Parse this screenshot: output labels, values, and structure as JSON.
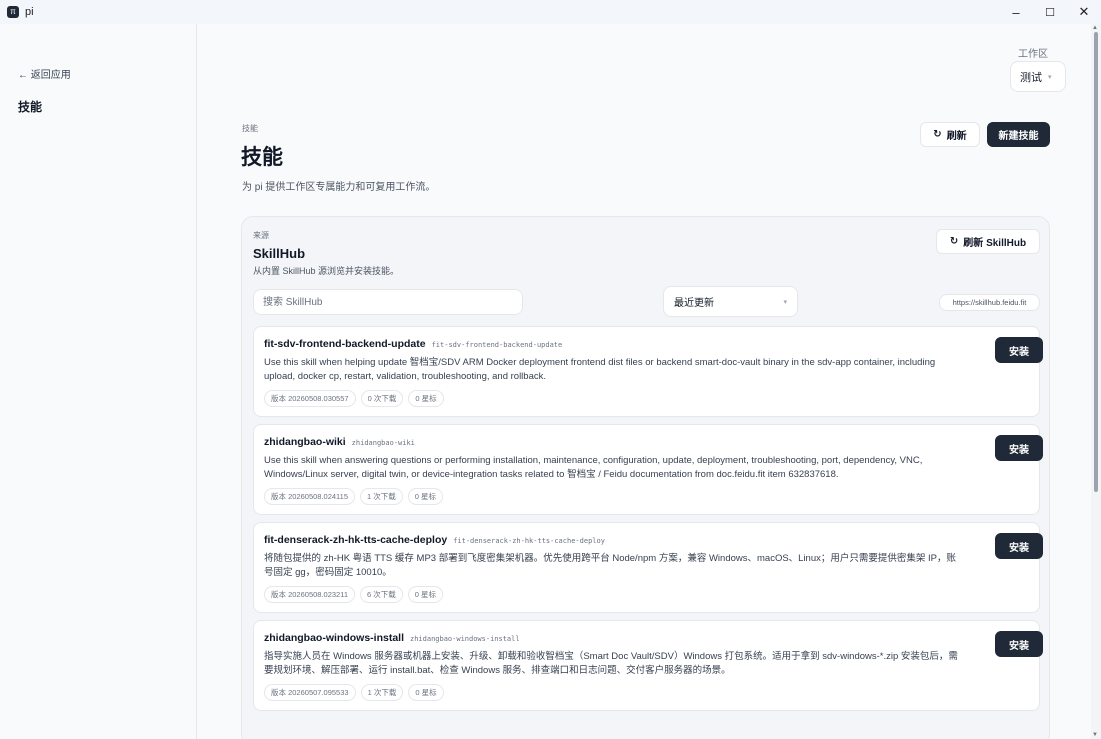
{
  "window": {
    "app_icon": "π",
    "title": "pi",
    "minimize": "–",
    "maximize": "☐",
    "close": "✕"
  },
  "sidebar": {
    "back_label": "← 返回应用",
    "heading": "技能"
  },
  "workspace": {
    "label": "工作区",
    "value": "测试",
    "caret": "▾"
  },
  "header": {
    "breadcrumb": "技能",
    "title": "技能",
    "description": "为 pi 提供工作区专属能力和可复用工作流。",
    "refresh_label": "刷新",
    "refresh_icon": "↻",
    "new_label": "新建技能"
  },
  "source": {
    "label": "来源",
    "title": "SkillHub",
    "description": "从内置 SkillHub 源浏览并安装技能。",
    "refresh_label": "刷新 SkillHub",
    "refresh_icon": "↻",
    "search_placeholder": "搜索 SkillHub",
    "sort_value": "最近更新",
    "sort_caret": "▾",
    "url": "https://skillhub.feidu.fit"
  },
  "skills": [
    {
      "name": "fit-sdv-frontend-backend-update",
      "slug": "fit-sdv-frontend-backend-update",
      "description": "Use this skill when helping update 智档宝/SDV ARM Docker deployment frontend dist files or backend smart-doc-vault binary in the sdv-app container, including upload, docker cp, restart, validation, troubleshooting, and rollback.",
      "version": "版本 20260508.030557",
      "downloads": "0 次下载",
      "stars": "0 星标",
      "install_label": "安装"
    },
    {
      "name": "zhidangbao-wiki",
      "slug": "zhidangbao-wiki",
      "description": "Use this skill when answering questions or performing installation, maintenance, configuration, update, deployment, troubleshooting, port, dependency, VNC, Windows/Linux server, digital twin, or device-integration tasks related to 智档宝 / Feidu documentation from doc.feidu.fit item 632837618.",
      "version": "版本 20260508.024115",
      "downloads": "1 次下载",
      "stars": "0 星标",
      "install_label": "安装"
    },
    {
      "name": "fit-denserack-zh-hk-tts-cache-deploy",
      "slug": "fit-denserack-zh-hk-tts-cache-deploy",
      "description": "将随包提供的 zh-HK 粤语 TTS 缓存 MP3 部署到飞度密集架机器。优先使用跨平台 Node/npm 方案，兼容 Windows、macOS、Linux；用户只需要提供密集架 IP，账号固定 gg，密码固定 10010。",
      "version": "版本 20260508.023211",
      "downloads": "6 次下载",
      "stars": "0 星标",
      "install_label": "安装"
    },
    {
      "name": "zhidangbao-windows-install",
      "slug": "zhidangbao-windows-install",
      "description": "指导实施人员在 Windows 服务器或机器上安装、升级、卸载和验收智档宝（Smart Doc Vault/SDV）Windows 打包系统。适用于拿到 sdv-windows-*.zip 安装包后，需要规划环境、解压部署、运行 install.bat、检查 Windows 服务、排查端口和日志问题、交付客户服务器的场景。",
      "version": "版本 20260507.095533",
      "downloads": "1 次下载",
      "stars": "0 星标",
      "install_label": "安装"
    }
  ]
}
